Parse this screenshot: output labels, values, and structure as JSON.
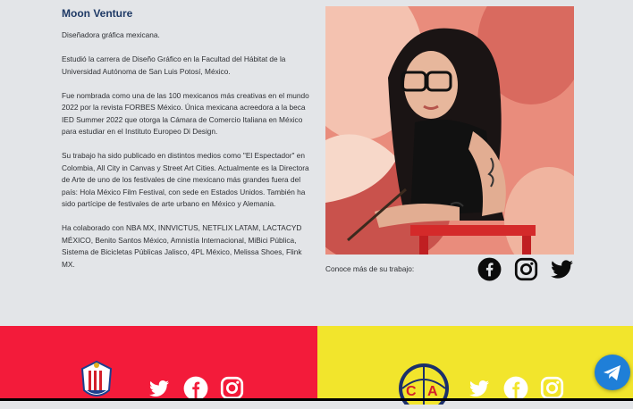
{
  "profile": {
    "name": "Moon Venture",
    "paragraphs": [
      "Diseñadora gráfica mexicana.",
      "Estudió la carrera de Diseño Gráfico en la Facultad del Hábitat de la Universidad Autónoma de San Luis Potosí, México.",
      "Fue nombrada como una de las 100 mexicanos más creativas en el mundo 2022 por la revista FORBES México. Única mexicana acreedora a la beca IED Summer 2022 que otorga la Cámara de Comercio Italiana en México para estudiar en el Instituto Europeo Di Design.",
      "Su trabajo ha sido publicado en distintos medios como \"El Espectador\" en Colombia, All City in Canvas y Street Art Cities. Actualmente es la Directora de Arte de uno de los festivales de cine mexicano más grandes fuera del país: Hola México Film Festival, con sede en Estados Unidos. También ha sido partícipe de festivales de arte urbano en México y Alemania.",
      "Ha colaborado con NBA MX, INNVICTUS, NETFLIX LATAM, LACTACYD MÉXICO, Benito Santos México, Amnistía Internacional, MiBici Pública, Sistema de Bicicletas Públicas Jalisco, 4PL México, Melissa Shoes, Flink MX."
    ]
  },
  "social_section": {
    "label": "Conoce más de su trabajo:",
    "icons": [
      "facebook-icon",
      "instagram-icon",
      "twitter-icon"
    ]
  },
  "footer": {
    "left": {
      "color": "#f31b3a",
      "crest": "chivas-crest",
      "icons": [
        "twitter-icon",
        "facebook-icon",
        "instagram-icon"
      ]
    },
    "right": {
      "color": "#f2e52c",
      "crest": "club-america-crest",
      "icons": [
        "twitter-icon",
        "facebook-icon",
        "instagram-icon"
      ]
    }
  },
  "colors": {
    "title": "#1f3a66",
    "telegram": "#1f7fd8"
  }
}
